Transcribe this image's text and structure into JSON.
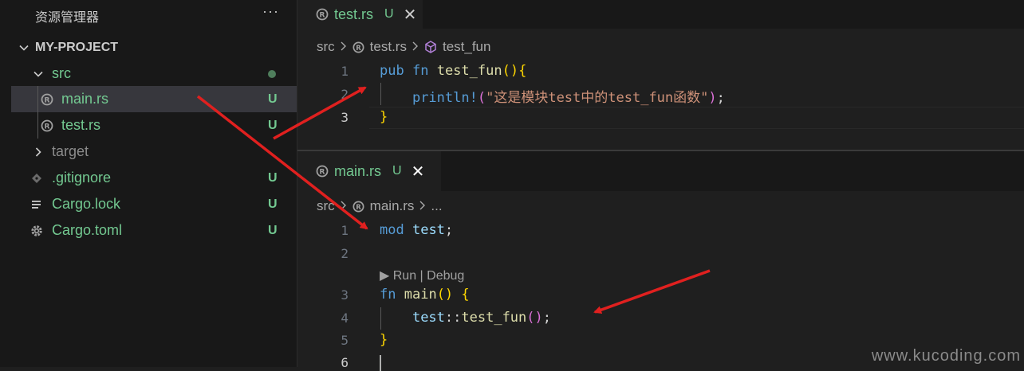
{
  "sidebar": {
    "title": "资源管理器",
    "more": "···",
    "project": "MY-PROJECT",
    "items": [
      {
        "label": "src",
        "status": ""
      },
      {
        "label": "main.rs",
        "status": "U"
      },
      {
        "label": "test.rs",
        "status": "U"
      },
      {
        "label": "target",
        "status": ""
      },
      {
        "label": ".gitignore",
        "status": "U"
      },
      {
        "label": "Cargo.lock",
        "status": "U"
      },
      {
        "label": "Cargo.toml",
        "status": "U"
      }
    ]
  },
  "editor_top": {
    "tab": {
      "label": "test.rs",
      "status": "U",
      "close": "✕"
    },
    "breadcrumb": {
      "root": "src",
      "file": "test.rs",
      "symbol": "test_fun"
    },
    "line_numbers": [
      "1",
      "2",
      "3"
    ],
    "code": {
      "l1": {
        "kw1": "pub",
        "kw2": "fn",
        "fn": "test_fun",
        "p": "()",
        "b": "{"
      },
      "l2": {
        "mac": "println!",
        "p1": "(",
        "str": "\"这是模块test中的test_fun函数\"",
        "p2": ")",
        "semi": ";"
      },
      "l3": {
        "b": "}"
      }
    }
  },
  "editor_bottom": {
    "tab": {
      "label": "main.rs",
      "status": "U",
      "close": "✕"
    },
    "breadcrumb": {
      "root": "src",
      "file": "main.rs",
      "more": "..."
    },
    "line_numbers": [
      "1",
      "2",
      "3",
      "4",
      "5",
      "6"
    ],
    "code_lens": "▶ Run | Debug",
    "code": {
      "l1": {
        "kw": "mod",
        "id": "test",
        "semi": ";"
      },
      "l3": {
        "kw": "fn",
        "fn": "main",
        "p": "()",
        "b": "{"
      },
      "l4": {
        "mod": "test",
        "sep": "::",
        "fn": "test_fun",
        "p": "()",
        "semi": ";"
      },
      "l5": {
        "b": "}"
      }
    }
  },
  "watermark": "www.kucoding.com",
  "colors": {
    "accent": "#73c991",
    "arrow": "#e0201f",
    "rust_icon": "#a0a0a0"
  }
}
